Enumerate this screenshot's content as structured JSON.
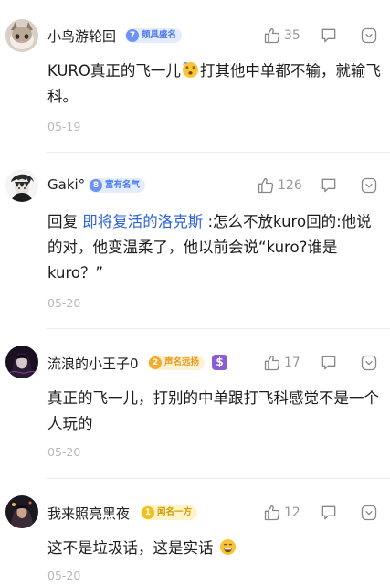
{
  "comments": [
    {
      "username": "小鸟游轮回",
      "level": "7",
      "badge": "颇具盛名",
      "likes": "35",
      "text_before": "KURO真正的飞一儿",
      "text_after": "打其他中单都不输，就输飞科。",
      "date": "05-19"
    },
    {
      "username": "Gaki°",
      "level": "8",
      "badge": "富有名气",
      "likes": "126",
      "reply_prefix": "回复 ",
      "reply_to": "即将复活的洛克斯",
      "text": " :怎么不放kuro回的:他说的对，他变温柔了，他以前会说“kuro?谁是kuro？”",
      "date": "05-20"
    },
    {
      "username": "流浪的小王子0",
      "level": "2",
      "badge": "声名远扬",
      "extra_badge": "$",
      "likes": "17",
      "text": "真正的飞一儿，打别的中单跟打飞科感觉不是一个人玩的",
      "date": "05-20"
    },
    {
      "username": "我来照亮黑夜",
      "level": "1",
      "badge": "闻名一方",
      "likes": "12",
      "text": "这不是垃圾话，这是实话",
      "date": "05-20"
    }
  ],
  "colors": {
    "mention": "#2f63d8",
    "badge_blue": "#4d7cf0",
    "badge_orange": "#e89a17",
    "badge_yellow": "#cf9a06",
    "muted": "#999999"
  }
}
